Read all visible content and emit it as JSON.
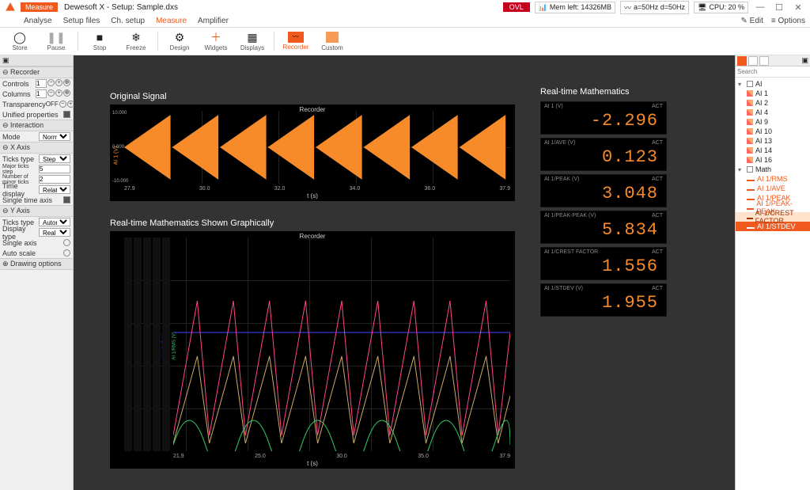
{
  "title": "Dewesoft X - Setup: Sample.dxs",
  "orange_pill": "Measure",
  "status": {
    "ovl": "OVL",
    "mem": "Mem left: 14326MB",
    "freq": "a=50Hz d=50Hz",
    "cpu": "CPU: 20 %"
  },
  "sysmenu": {
    "edit": "Edit",
    "options": "Options"
  },
  "tabs": {
    "analyse": "Analyse",
    "setup_files": "Setup files",
    "ch_setup": "Ch. setup",
    "measure": "Measure",
    "amplifier": "Amplifier"
  },
  "toolbar": {
    "store": "Store",
    "pause": "Pause",
    "stop": "Stop",
    "freeze": "Freeze",
    "design": "Design",
    "widgets": "Widgets",
    "displays": "Displays",
    "recorder": "Recorder",
    "custom": "Custom"
  },
  "left": {
    "recorder": "Recorder",
    "controls_lbl": "Controls",
    "controls_val": "1",
    "columns_lbl": "Columns",
    "columns_val": "1",
    "transparency_lbl": "Transparency",
    "transparency_val": "OFF",
    "unified_lbl": "Unified properties",
    "interaction": "Interaction",
    "mode_lbl": "Mode",
    "mode_val": "Normal",
    "xaxis": "X Axis",
    "ticks_type_lbl": "Ticks type",
    "ticks_type_val": "Step",
    "major_step_lbl": "Major ticks step",
    "major_step_val": "5",
    "minor_num_lbl": "Number of minor ticks",
    "minor_num_val": "2",
    "time_disp_lbl": "Time display",
    "time_disp_val": "Relative",
    "single_time_lbl": "Single time axis",
    "yaxis": "Y Axis",
    "yticks_type_lbl": "Ticks type",
    "yticks_type_val": "Automatic",
    "disp_type_lbl": "Display type",
    "disp_type_val": "Real value",
    "single_axis_lbl": "Single axis",
    "auto_scale_lbl": "Auto scale",
    "drawing": "Drawing options"
  },
  "headings": {
    "orig": "Original Signal",
    "graph": "Real-time Mathematics Shown Graphically",
    "rt": "Real-time Mathematics"
  },
  "plot": {
    "recorder": "Recorder",
    "xlabel": "t (s)",
    "y_top": "10.000",
    "y_mid": "0.000",
    "y_bot": "-10.000",
    "ylabel": "AI 1 (V)"
  },
  "chart_data": [
    {
      "type": "line",
      "title": "Original Signal Recorder",
      "xlabel": "t (s)",
      "ylabel": "AI 1 (V)",
      "xlim": [
        27.9,
        37.9
      ],
      "ylim": [
        -10,
        10
      ],
      "xticks": [
        27.9,
        30.0,
        32.0,
        34.0,
        36.0,
        37.9
      ],
      "waveform": "repeating sawtooth bursts, 8 bursts, peak ±10"
    },
    {
      "type": "line",
      "title": "Real-time Mathematics Recorder",
      "xlabel": "t (s)",
      "xlim": [
        21.9,
        37.9
      ],
      "ylim": [
        0,
        10
      ],
      "xticks": [
        21.9,
        25.0,
        30.0,
        35.0,
        37.9
      ],
      "series": [
        {
          "name": "AI 1/STDEV (-)",
          "color": "#ff3355"
        },
        {
          "name": "AI 1/CREST FACTOR (-)",
          "color": "#cc9955"
        },
        {
          "name": "AI 1/PEAK (V)",
          "color": "#aa66ff"
        },
        {
          "name": "AI 1/AVE (V)",
          "color": "#4444ff"
        },
        {
          "name": "AI 1/RMS (V)",
          "color": "#33cc66"
        }
      ]
    }
  ],
  "rt": [
    {
      "name": "AI 1 (V)",
      "unit": "ACT",
      "val": "-2.296"
    },
    {
      "name": "AI 1/AVE (V)",
      "unit": "ACT",
      "val": "0.123"
    },
    {
      "name": "AI 1/PEAK (V)",
      "unit": "ACT",
      "val": "3.048"
    },
    {
      "name": "AI 1/PEAK-PEAK (V)",
      "unit": "ACT",
      "val": "5.834"
    },
    {
      "name": "AI 1/CREST FACTOR",
      "unit": "ACT",
      "val": "1.556"
    },
    {
      "name": "AI 1/STDEV (V)",
      "unit": "ACT",
      "val": "1.955"
    }
  ],
  "tree": {
    "search_ph": "Search",
    "root_ai": "AI",
    "ai_items": [
      "AI 1",
      "AI 2",
      "AI 4",
      "AI 9",
      "AI 10",
      "AI 13",
      "AI 14",
      "AI 16"
    ],
    "root_math": "Math",
    "math_items": [
      "AI 1/RMS",
      "AI 1/AVE",
      "AI 1/PEAK",
      "AI 1/PEAK-PEAK",
      "AI 1/CREST FACTOR",
      "AI 1/STDEV"
    ]
  },
  "xticks1": [
    "27.9",
    "30.0",
    "32.0",
    "34.0",
    "36.0",
    "37.9"
  ],
  "xticks2": [
    "21.9",
    "25.0",
    "30.0",
    "35.0",
    "37.9"
  ]
}
